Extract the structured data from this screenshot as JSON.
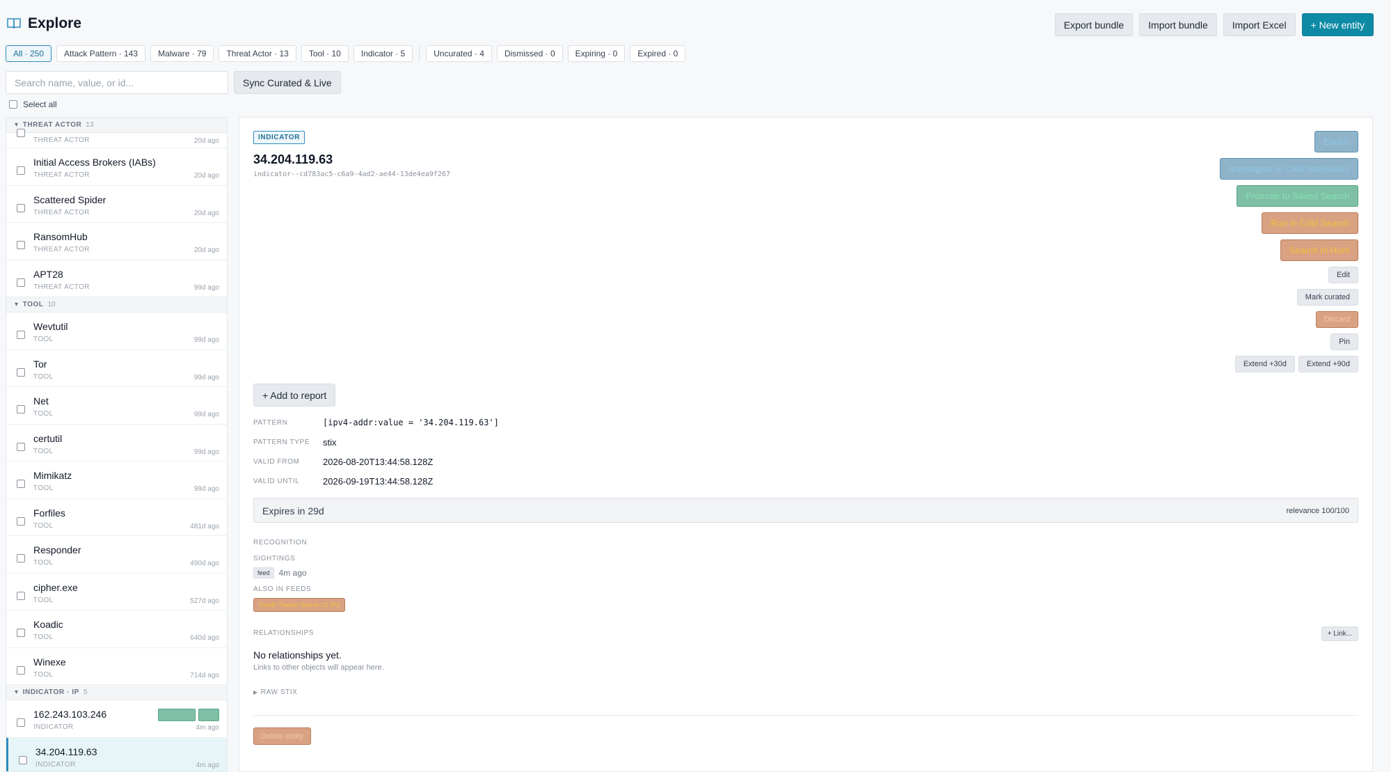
{
  "header": {
    "title": "Explore",
    "buttons": {
      "export": "Export bundle",
      "import": "Import bundle",
      "import_excel": "Import Excel",
      "new_entity": "+ New entity"
    }
  },
  "chips": [
    "All · 250",
    "Attack Pattern · 143",
    "Malware · 79",
    "Threat Actor · 13",
    "Tool · 10",
    "Indicator · 5",
    "Uncurated · 4",
    "Dismissed · 0",
    "Expiring · 0",
    "Expired · 0"
  ],
  "search": {
    "placeholder": "Search name, value, or id..."
  },
  "sync_label": "Sync Curated & Live",
  "select_all": "Select all",
  "list": {
    "groups": [
      {
        "label": "THREAT ACTOR",
        "count": "13",
        "partial": {
          "type": "THREAT ACTOR",
          "age": "20d ago"
        },
        "items": [
          {
            "name": "Initial Access Brokers (IABs)",
            "type": "THREAT ACTOR",
            "age": "20d ago"
          },
          {
            "name": "Scattered Spider",
            "type": "THREAT ACTOR",
            "age": "20d ago"
          },
          {
            "name": "RansomHub",
            "type": "THREAT ACTOR",
            "age": "20d ago"
          },
          {
            "name": "APT28",
            "type": "THREAT ACTOR",
            "age": "99d ago"
          }
        ]
      },
      {
        "label": "TOOL",
        "count": "10",
        "items": [
          {
            "name": "Wevtutil",
            "type": "TOOL",
            "age": "99d ago"
          },
          {
            "name": "Tor",
            "type": "TOOL",
            "age": "99d ago"
          },
          {
            "name": "Net",
            "type": "TOOL",
            "age": "99d ago"
          },
          {
            "name": "certutil",
            "type": "TOOL",
            "age": "99d ago"
          },
          {
            "name": "Mimikatz",
            "type": "TOOL",
            "age": "99d ago"
          },
          {
            "name": "Forfiles",
            "type": "TOOL",
            "age": "481d ago"
          },
          {
            "name": "Responder",
            "type": "TOOL",
            "age": "490d ago"
          },
          {
            "name": "cipher.exe",
            "type": "TOOL",
            "age": "527d ago"
          },
          {
            "name": "Koadic",
            "type": "TOOL",
            "age": "640d ago"
          },
          {
            "name": "Winexe",
            "type": "TOOL",
            "age": "714d ago"
          }
        ]
      },
      {
        "label": "INDICATOR · IP",
        "count": "5",
        "items": [
          {
            "name": "162.243.103.246",
            "type": "INDICATOR",
            "age": "4m ago",
            "badges": true
          },
          {
            "name": "34.204.119.63",
            "type": "INDICATOR",
            "age": "4m ago",
            "selected": true
          }
        ]
      }
    ]
  },
  "detail": {
    "type_tag": "INDICATOR",
    "title": "34.204.119.63",
    "id": "indicator--cd783ac5-c6a9-4ad2-ae44-13de4ea9f267",
    "actions": {
      "enrich": "Enrich",
      "investigate": "Investigate in Cribl Notebooks",
      "promote": "Promote to Saved Search",
      "run_search": "Run in Cribl Search",
      "search_hunt": "Search in Hunt",
      "edit": "Edit",
      "mark_curated": "Mark curated",
      "discard": "Discard",
      "pin": "Pin",
      "extend30": "Extend +30d",
      "extend90": "Extend +90d"
    },
    "add_report": "+ Add to report",
    "fields": {
      "pattern_k": "PATTERN",
      "pattern_v": "[ipv4-addr:value = '34.204.119.63']",
      "ptype_k": "PATTERN TYPE",
      "ptype_v": "stix",
      "vfrom_k": "VALID FROM",
      "vfrom_v": "2026-08-20T13:44:58.128Z",
      "vuntil_k": "VALID UNTIL",
      "vuntil_v": "2026-09-19T13:44:58.128Z"
    },
    "expires": "Expires in 29d",
    "relevance": "relevance 100/100",
    "recognition": "RECOGNITION",
    "sightings": "SIGHTINGS",
    "sighting_tag": "feed",
    "sighting_age": "4m ago",
    "also_in_feeds": "ALSO IN FEEDS",
    "feed_name": "Feodo Tracker Botnet C2 IPs",
    "relationships": "RELATIONSHIPS",
    "link_btn": "+ Link...",
    "no_rel": "No relationships yet.",
    "no_rel_sub": "Links to other objects will appear here.",
    "raw_stix": "RAW STIX",
    "delete": "Delete entity"
  }
}
